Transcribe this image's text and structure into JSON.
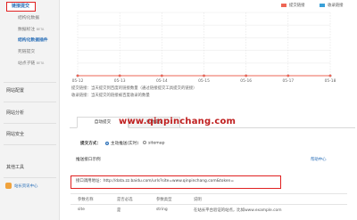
{
  "sidebar": {
    "items": [
      {
        "label": "链接提交",
        "kind": "first-active"
      },
      {
        "label": "结构化数据",
        "kind": "sub"
      },
      {
        "label": "数据标注",
        "kind": "sub",
        "badge": "BETA"
      },
      {
        "label": "结构化数据插件",
        "kind": "sub-active"
      },
      {
        "label": "死链提交",
        "kind": "sub"
      },
      {
        "label": "站点子链",
        "kind": "sub",
        "badge": "BETA"
      },
      {
        "label": "网站配置",
        "kind": "group"
      },
      {
        "label": "网站分析",
        "kind": "group"
      },
      {
        "label": "网站安全",
        "kind": "group"
      },
      {
        "label": "其他工具",
        "kind": "group"
      }
    ],
    "notice": "站长资讯中心"
  },
  "legend": [
    {
      "label": "提交链接",
      "color": "#ee6655"
    },
    {
      "label": "收录链接",
      "color": "#3aa0d8"
    }
  ],
  "chart_data": {
    "type": "line",
    "x": [
      "05-12",
      "05-13",
      "05-14",
      "05-15",
      "05-16",
      "05-17",
      "05-18"
    ],
    "series": [
      {
        "name": "提交链接",
        "values": [
          0,
          0,
          0,
          0,
          0,
          0,
          0
        ],
        "color": "#ee6655"
      },
      {
        "name": "收录链接",
        "values": [
          0,
          0,
          0,
          0,
          0,
          0,
          0
        ],
        "color": "#3aa0d8"
      }
    ],
    "grid": true
  },
  "notes": [
    "提交链接：当天提交到百度的链接数量（通过链接提交工具提交的链接）",
    "收录链接：当天提交的链接被百度收录的数量"
  ],
  "tabs": [
    "自动提交",
    "手动提交"
  ],
  "watermark": "www.qinpinchang.com",
  "form": {
    "method_label": "提交方式：",
    "options": [
      {
        "label": "主动推送(实时)",
        "checked": true
      },
      {
        "label": "sitemap",
        "checked": false
      }
    ],
    "example_title": "推送接口示例",
    "help_link": "帮助中心",
    "api_label": "接口调用地址：",
    "api_url": "http://data.zz.baidu.com/urls?site=www.qinpinchang.com&token=",
    "table": {
      "headers": [
        "参数名称",
        "是否必选",
        "参数类型",
        "说明"
      ],
      "rows": [
        [
          "site",
          "是",
          "string",
          "在站长平台验证的站点，比如www.example.com"
        ]
      ]
    }
  }
}
